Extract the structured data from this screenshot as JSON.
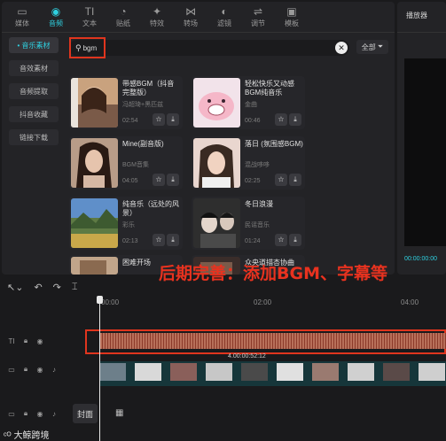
{
  "toolbar": {
    "tabs": [
      {
        "label": "媒体",
        "icon": "media-icon",
        "glyph": "▭",
        "active": false
      },
      {
        "label": "音频",
        "icon": "audio-icon",
        "glyph": "◉",
        "active": true
      },
      {
        "label": "文本",
        "icon": "text-icon",
        "glyph": "TI",
        "active": false
      },
      {
        "label": "贴纸",
        "icon": "sticker-icon",
        "glyph": "◔",
        "active": false
      },
      {
        "label": "特效",
        "icon": "effects-icon",
        "glyph": "✦",
        "active": false
      },
      {
        "label": "转场",
        "icon": "transition-icon",
        "glyph": "⋈",
        "active": false
      },
      {
        "label": "滤镜",
        "icon": "filter-icon",
        "glyph": "◐",
        "active": false
      },
      {
        "label": "调节",
        "icon": "adjust-icon",
        "glyph": "⇌",
        "active": false
      },
      {
        "label": "模板",
        "icon": "template-icon",
        "glyph": "▣",
        "active": false
      }
    ]
  },
  "sidebar": {
    "items": [
      {
        "label": "• 音乐素材",
        "active": true
      },
      {
        "label": "音效素材",
        "active": false
      },
      {
        "label": "音频提取",
        "active": false
      },
      {
        "label": "抖音收藏",
        "active": false
      },
      {
        "label": "链接下载",
        "active": false
      }
    ]
  },
  "search": {
    "value": "bgm",
    "filter_label": "全部"
  },
  "cards": [
    {
      "title": "带感BGM（抖音完整版）",
      "artist": "冯超琦+黑匹兹",
      "duration": "02:54"
    },
    {
      "title": "轻松快乐又动感BGM纯音乐",
      "artist": "金曲",
      "duration": "00:46"
    },
    {
      "title": "Mine(副音版)",
      "artist": "BGM音集",
      "duration": "04:05"
    },
    {
      "title": "落日 (氛围感BGM)",
      "artist": "混战哆哆",
      "duration": "02:25"
    },
    {
      "title": "纯音乐（远处的风景）",
      "artist": "彩乐",
      "duration": "02:13"
    },
    {
      "title": "冬日浪漫",
      "artist": "民谣音乐",
      "duration": "01:24"
    },
    {
      "title": "困难开场",
      "artist": "",
      "duration": ""
    },
    {
      "title": "众央道描杏协曲",
      "artist": "",
      "duration": ""
    }
  ],
  "player": {
    "title": "播放器",
    "time": "00:00:00:00"
  },
  "overlay_caption": "后期完善：添加BGM、字幕等",
  "timeline": {
    "ruler": [
      "00:00",
      "02:00",
      "04:00"
    ],
    "video_meta": "4.00:00:52:12",
    "cover_label": "封面",
    "text_track_label": "TI"
  },
  "watermark": "大鲸跨境",
  "colors": {
    "accent": "#2fd0e0",
    "highlight": "#e0351e",
    "caption": "#e8321f"
  }
}
